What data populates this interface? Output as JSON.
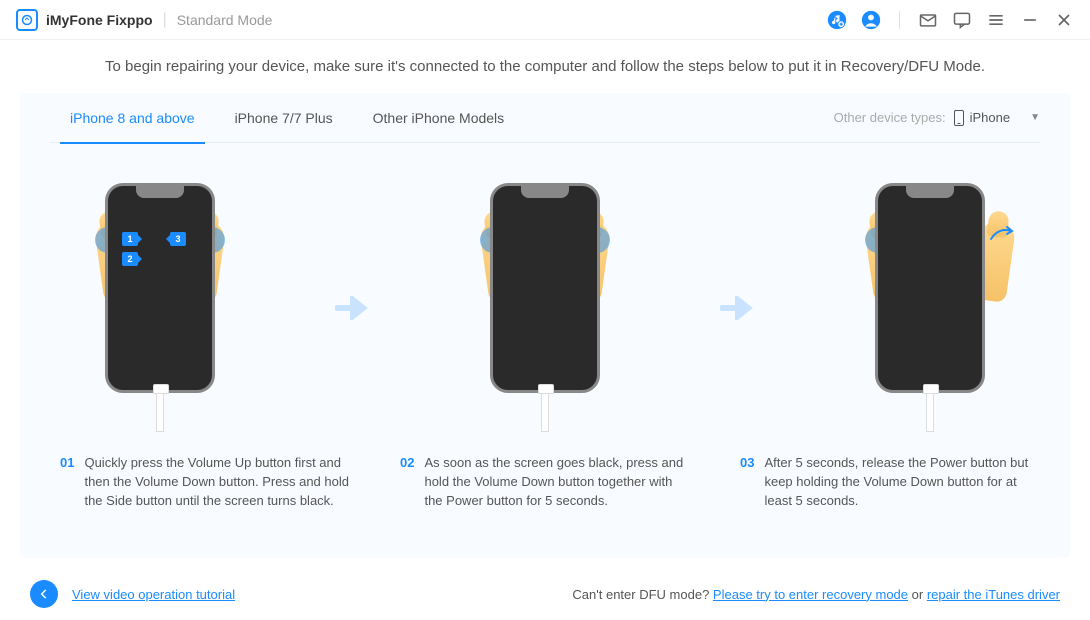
{
  "app": {
    "title": "iMyFone Fixppo",
    "mode": "Standard Mode"
  },
  "intro": "To begin repairing your device, make sure it's connected to the computer and follow the steps below to put it in Recovery/DFU Mode.",
  "tabs": [
    {
      "label": "iPhone 8 and above",
      "active": true
    },
    {
      "label": "iPhone 7/7 Plus",
      "active": false
    },
    {
      "label": "Other iPhone Models",
      "active": false
    }
  ],
  "device_type": {
    "label": "Other device types:",
    "selected": "iPhone"
  },
  "steps": [
    {
      "num": "01",
      "text": "Quickly press the Volume Up button first and then the Volume Down button. Press and hold the Side button until the screen turns black."
    },
    {
      "num": "02",
      "text": "As soon as the screen goes black, press and hold the Volume Down button together with the Power button for 5 seconds."
    },
    {
      "num": "03",
      "text": "After 5 seconds, release the Power button but keep holding the Volume Down button for at least 5 seconds."
    }
  ],
  "footer": {
    "tutorial_link": "View video operation tutorial",
    "help_prefix": "Can't enter DFU mode? ",
    "recovery_link": "Please try to enter recovery mode",
    "or": " or ",
    "driver_link": "repair the iTunes driver"
  }
}
